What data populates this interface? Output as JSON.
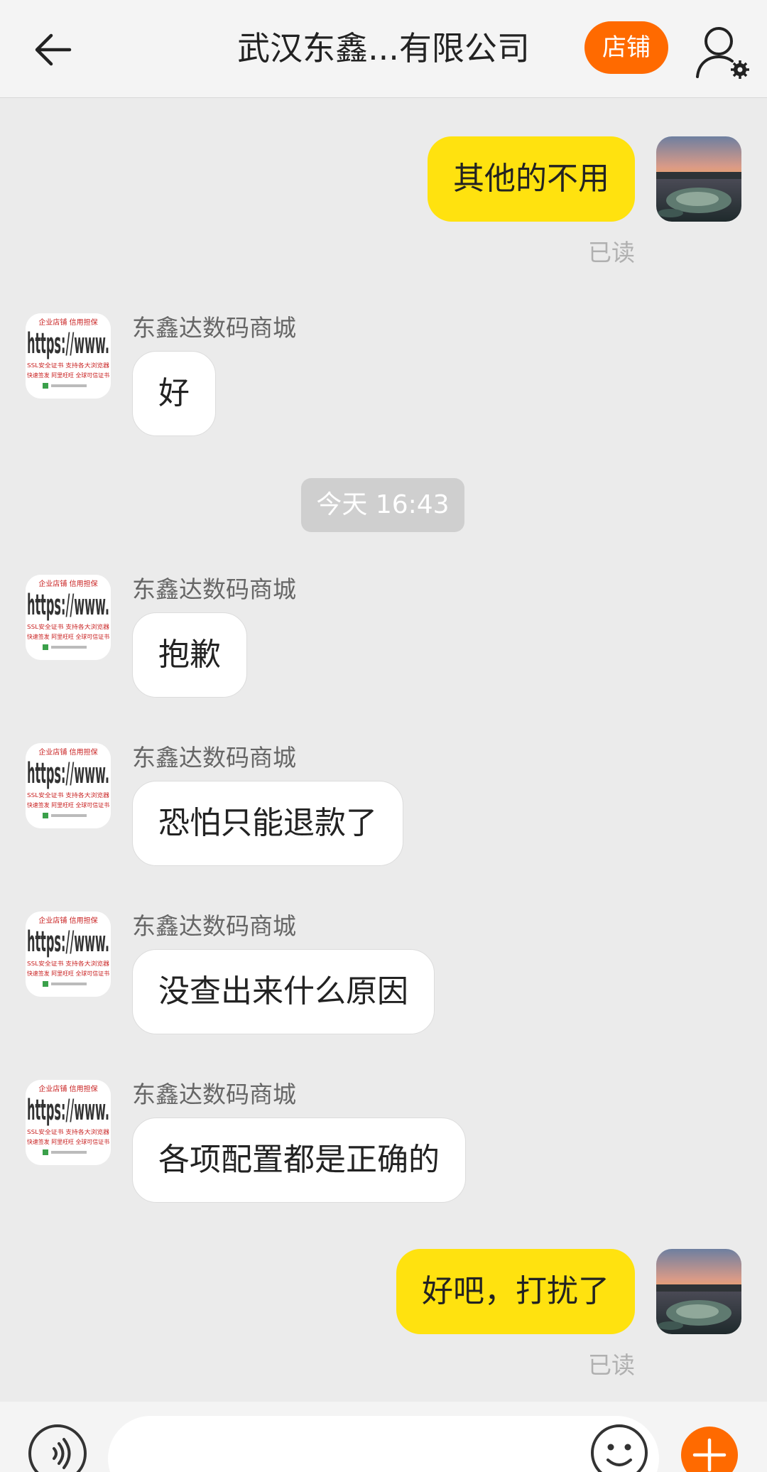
{
  "header": {
    "title": "武汉东鑫...有限公司",
    "shop_label": "店铺"
  },
  "messages": [
    {
      "side": "right",
      "text": "其他的不用",
      "status": "已读"
    },
    {
      "side": "left",
      "sender": "东鑫达数码商城",
      "text": "好"
    },
    {
      "side": "center",
      "time": "今天  16:43"
    },
    {
      "side": "left",
      "sender": "东鑫达数码商城",
      "text": "抱歉"
    },
    {
      "side": "left",
      "sender": "东鑫达数码商城",
      "text": "恐怕只能退款了"
    },
    {
      "side": "left",
      "sender": "东鑫达数码商城",
      "text": "没查出来什么原因"
    },
    {
      "side": "left",
      "sender": "东鑫达数码商城",
      "text": "各项配置都是正确的"
    },
    {
      "side": "right",
      "text": "好吧，打扰了",
      "status": "已读"
    }
  ],
  "shop_avatar": {
    "banner_text": "企业店铺  信用担保",
    "big_text": "https://www.",
    "line1": "SSL安全证书 支持各大浏览器",
    "line2": "快速签发 阿里旺旺 全球可信证书"
  },
  "icons": {
    "back": "arrow-left-icon",
    "profile": "user-settings-icon",
    "voice": "voice-icon",
    "emoji": "emoji-icon",
    "plus": "plus-icon"
  },
  "colors": {
    "accent": "#ff6a00",
    "my_bubble": "#ffe20f",
    "background": "#ebebeb"
  }
}
